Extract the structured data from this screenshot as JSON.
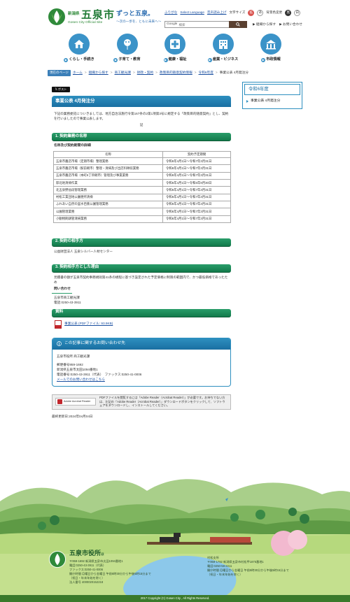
{
  "header": {
    "logo_small": "新潟県",
    "logo_big": "五泉市",
    "logo_en": "Gosen City Official Site",
    "slogan": "ずっと五泉。",
    "slogan_sub": "〜次の一歩を、ともに未来へ〜",
    "util": {
      "furigana": "ふりがな",
      "language": "Select Language",
      "readaloud": "音声読み上げ",
      "fontsize_label": "文字サイズ",
      "fontsize_large": "拡",
      "fontsize_reset": "あ",
      "color_label": "背景色変更",
      "color_dark": "黒",
      "color_default": "白"
    },
    "search": {
      "engine": "Google",
      "placeholder": "検索"
    },
    "link_org": "組織から探す",
    "link_inquiry": "お問い合わせ"
  },
  "nav": [
    {
      "label": "くらし・手続き",
      "icon": "house-icon"
    },
    {
      "label": "子育て・教育",
      "icon": "balloon-icon"
    },
    {
      "label": "健康・福祉",
      "icon": "medical-cross-icon"
    },
    {
      "label": "産業・ビジネス",
      "icon": "building-icon"
    },
    {
      "label": "市政情報",
      "icon": "city-hall-icon"
    }
  ],
  "breadcrumb": {
    "badge": "現在のページ",
    "items": [
      "ホーム",
      "組織から探す",
      "商工観光課",
      "財政・契約",
      "政策目的随意契約情報",
      "令和6年度"
    ],
    "current": "事業公表 4月発注分"
  },
  "main": {
    "share_label": "ポスト",
    "title": "事業公表 4月発注分",
    "intro": "下記の業務委託についきましては、地方自治法施行令第167条の2第1項第3号に規定する「政策目的随意契約」とし、契約を行いましたので事業公表します。",
    "note": "記",
    "section1": {
      "heading": "1. 契約業務の名称",
      "subheading": "名称及び契約期間の詳細",
      "columns": [
        "名称",
        "契約予定期間"
      ],
      "rows": [
        [
          "五泉市農店市場（定期市場）整理業務",
          "令和6年4月1日～令和7年3月31日"
        ],
        [
          "五泉市農店市場（駅前朝市）整理・清掃及び出店料徴収業務",
          "令和6年4月1日～令和7年3月31日"
        ],
        [
          "五泉市農店市場（本町6丁目朝市）管理及び事業業務",
          "令和6年4月1日～令和7年3月31日"
        ],
        [
          "邸北地清掃作業",
          "令和6年4月1日～令和6年9月30日"
        ],
        [
          "北五泉野益段管理業務",
          "令和6年4月1日～令和7年3月31日"
        ],
        [
          "村松工業団地公園便所清掃",
          "令和6年4月1日～令和7年3月31日"
        ],
        [
          "ふれあい自然の里水芭蕉公園管理業務",
          "令和6年4月1日～令和7年3月31日"
        ],
        [
          "公園管理業務",
          "令和6年4月1日～令和7年3月31日"
        ],
        [
          "小動物飼鶏管清掃業務",
          "令和6年4月1日～令和7年3月31日"
        ]
      ]
    },
    "section2": {
      "heading": "2. 契約の相手方",
      "text": "公益財団法人 五泉シルバー人材センター"
    },
    "section3": {
      "heading": "3. 契約相手方とした理由",
      "text": "見積書の額が五泉市契約事務規則第41条の規程に基づき設定された予定価格に制限の範囲内で、かつ最低価格であったため",
      "inquiry_heading": "問い合わせ",
      "inquiry_dept": "五泉市商工観光課",
      "inquiry_tel": "電話:0250-43-3911"
    },
    "materials": {
      "heading": "資料",
      "pdf_link": "事業公表 (PDFファイル: 93.9KB)"
    },
    "contact": {
      "heading": "この記事に関するお問い合わせ先",
      "dept": "五泉市役所 商工観光課",
      "zip": "郵便番号959-1692",
      "address": "新潟県五泉市太田1094番地1",
      "phone": "電話番号:0250-43-3911（代表）　ファックス:0250-41-0006",
      "form_link": "メールでのお問い合わせはこちら"
    },
    "reader": {
      "badge": "Adobe Acrobat Reader",
      "text": "PDFファイルを閲覧するには「Adobe Reader（Acrobat Reader）」が必要です。お持ちでない方は、左記の「Adobe Reader（Acrobat Reader）」ダウンロードボタンをクリックして、ソフトウェアをダウンロードし、インストールしてください。"
    },
    "updated": "最終更新日:2024年04月04日"
  },
  "side": {
    "title": "令和6年度",
    "item": "事業公表 4月発注分"
  },
  "footer": {
    "office": "五泉市役所",
    "office_suffix": "ほ",
    "info_left": [
      "〒959-1692 新潟県五泉市太田1094番地1",
      "電話:0250-43-3911（代表）",
      "ファックス:0250-41-0006",
      "開庁時間 月曜日から金曜日 午前8時30分から午後5時15分まで",
      "（祝日・年末年始を除く）",
      "法人番号 4000020152218"
    ],
    "info_right": [
      "村松支所",
      "〒959-1792 新潟県五泉市村松甲1875番地1",
      "電話:0250-58-2211",
      "開庁時間 月曜日から金曜日 午前8時30分から午後5時15分まで",
      "（祝日・年末年始を除く）"
    ],
    "copyright": "2017 Copyright (C) Gosen City , All Rights Reserved."
  }
}
